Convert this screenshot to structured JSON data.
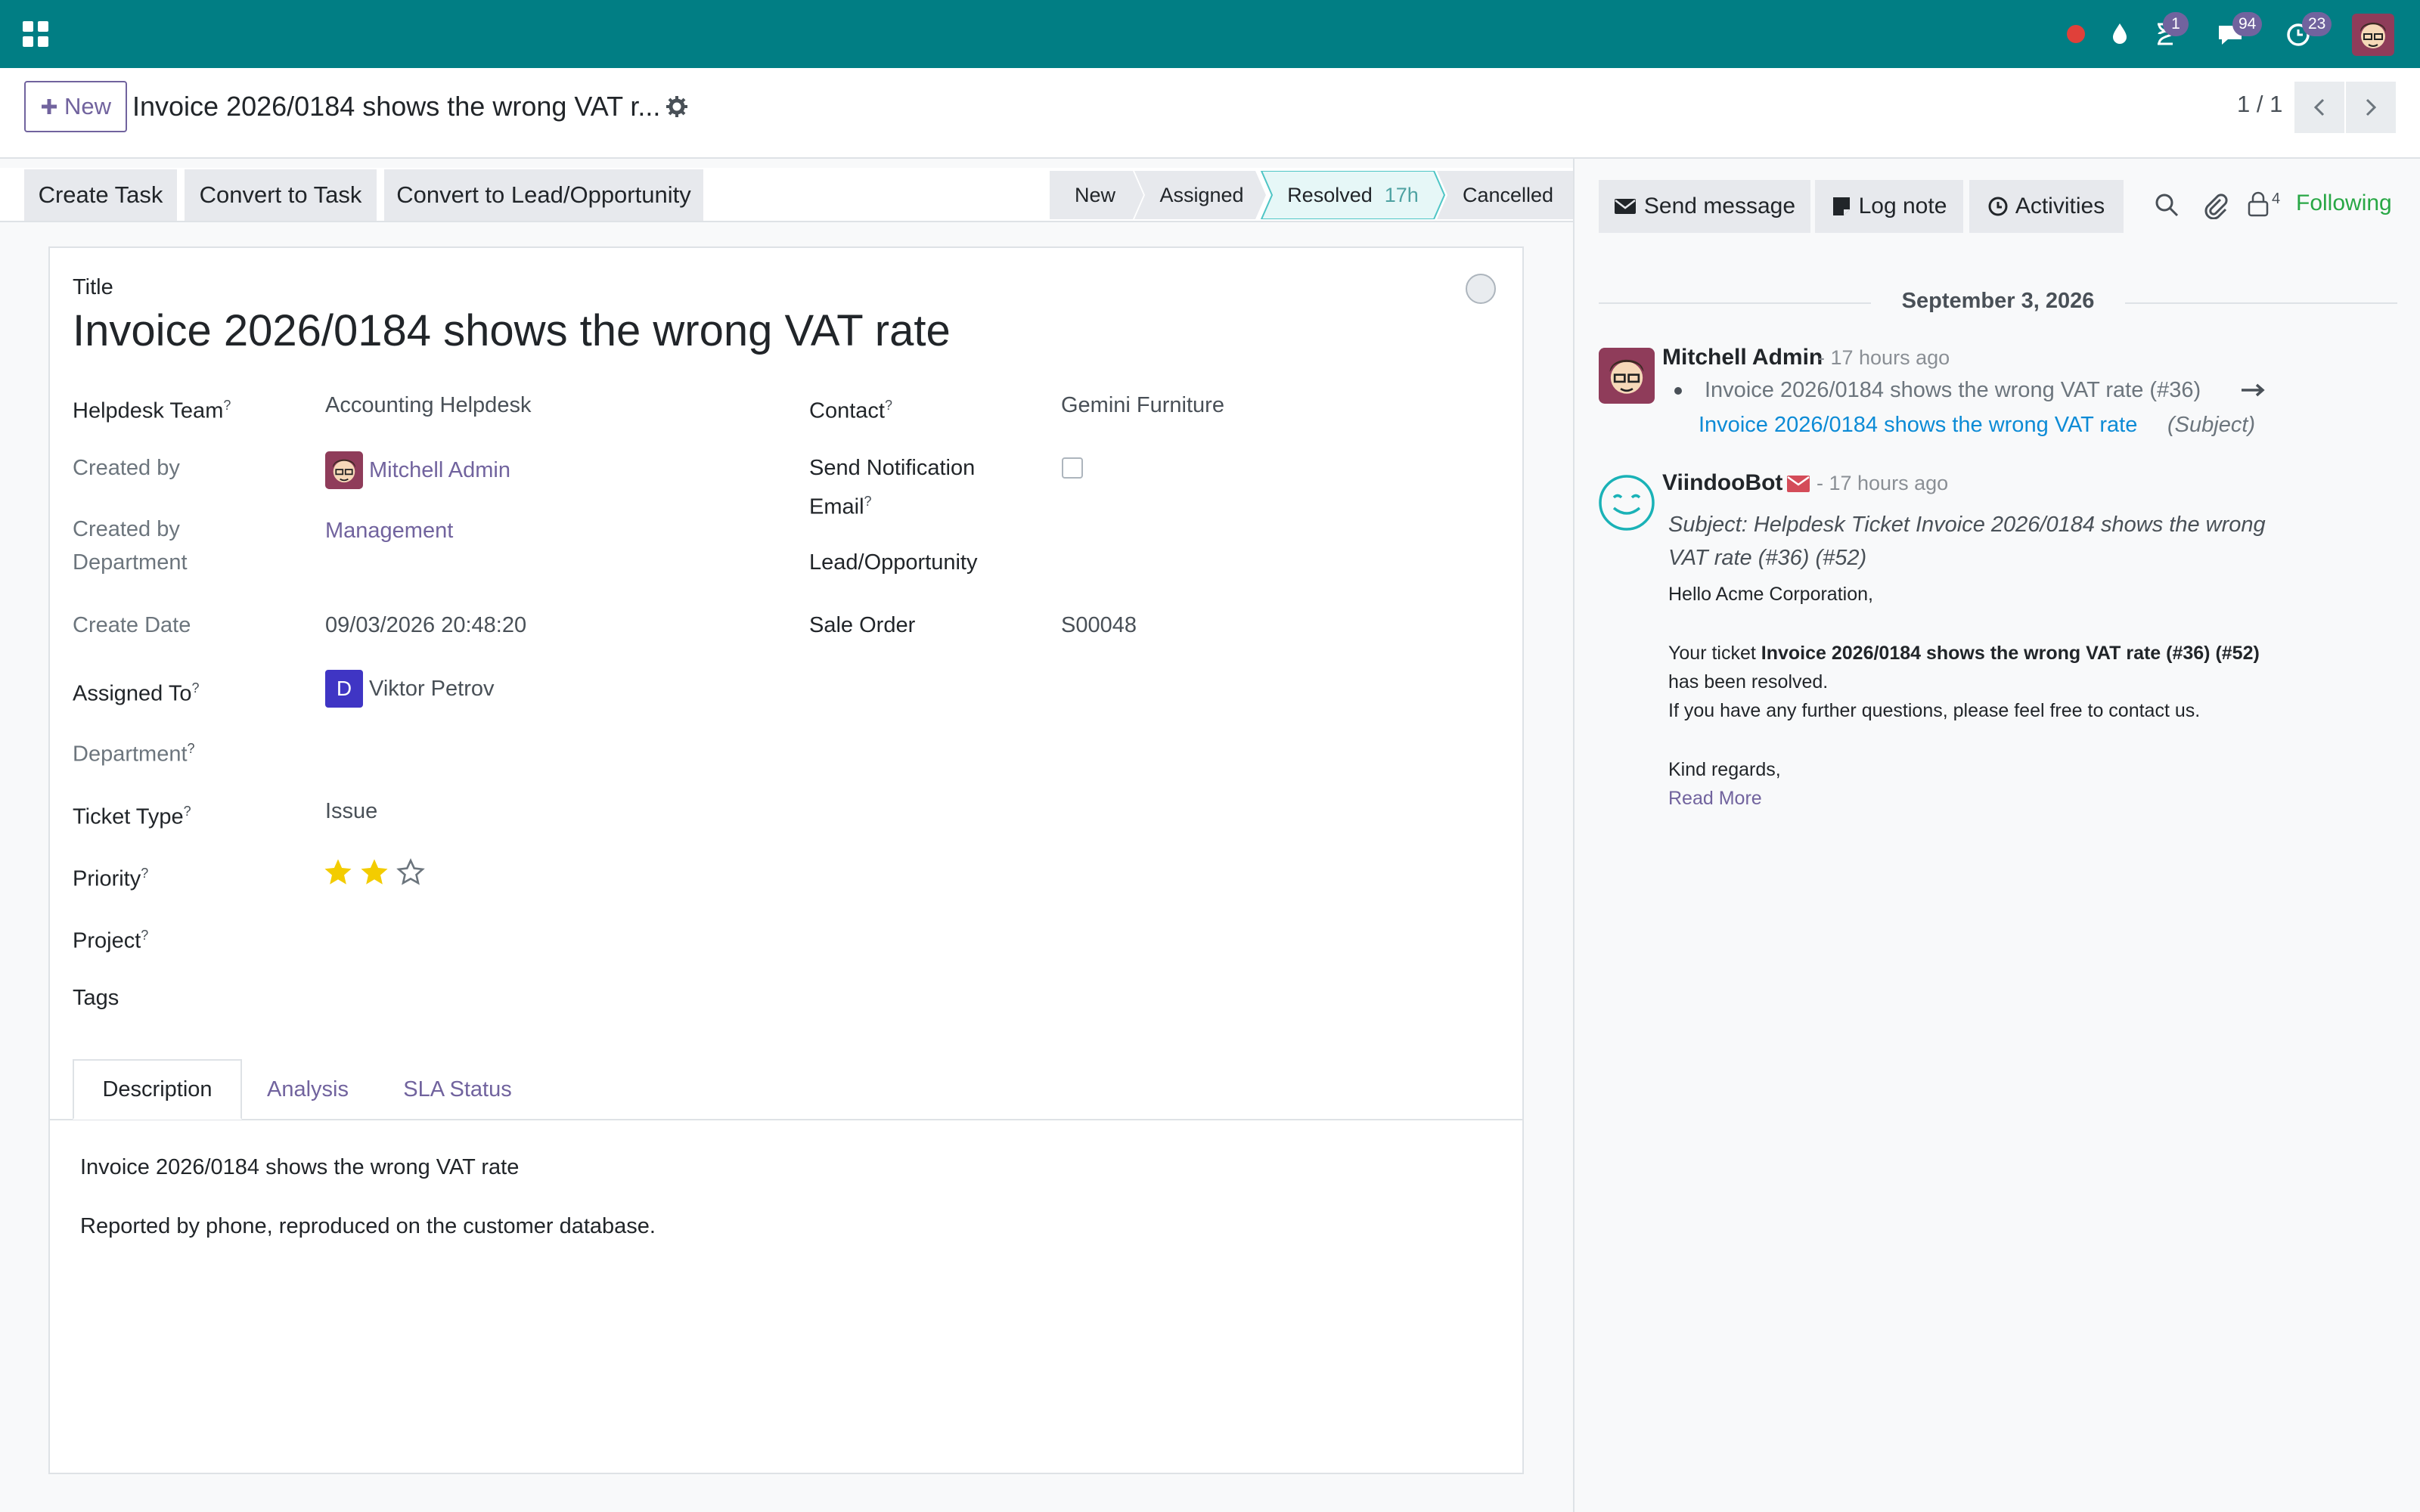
{
  "navbar": {
    "activity_badge": "1",
    "messages_badge": "94",
    "timesheet_badge": "23"
  },
  "control_panel": {
    "new_label": "New",
    "breadcrumb": "Invoice 2026/0184 shows the wrong VAT r...",
    "pager": "1 / 1"
  },
  "actions": {
    "create_task": "Create Task",
    "convert_task": "Convert to Task",
    "convert_lead": "Convert to Lead/Opportunity"
  },
  "stages": {
    "new": "New",
    "assigned": "Assigned",
    "resolved": "Resolved",
    "resolved_duration": "17h",
    "cancelled": "Cancelled"
  },
  "form": {
    "title_label": "Title",
    "title": "Invoice 2026/0184 shows the wrong VAT rate",
    "fields": {
      "helpdesk_team_label": "Helpdesk Team",
      "helpdesk_team": "Accounting Helpdesk",
      "created_by_label": "Created by",
      "created_by": "Mitchell Admin",
      "created_by_dept_label_1": "Created by",
      "created_by_dept_label_2": "Department",
      "created_by_dept": "Management",
      "create_date_label": "Create Date",
      "create_date": "09/03/2026 20:48:20",
      "assigned_to_label": "Assigned To",
      "assigned_to_initial": "D",
      "assigned_to": "Viktor Petrov",
      "department_label": "Department",
      "ticket_type_label": "Ticket Type",
      "ticket_type": "Issue",
      "priority_label": "Priority",
      "priority_value": 2,
      "priority_max": 3,
      "project_label": "Project",
      "tags_label": "Tags",
      "contact_label": "Contact",
      "contact": "Gemini Furniture",
      "send_notif_label_1": "Send Notification",
      "send_notif_label_2": "Email",
      "send_notification": false,
      "lead_label": "Lead/Opportunity",
      "sale_order_label": "Sale Order",
      "sale_order": "S00048",
      "help_mark": "?"
    },
    "tabs": [
      "Description",
      "Analysis",
      "SLA Status"
    ],
    "description": [
      "Invoice 2026/0184 shows the wrong VAT rate",
      "Reported by phone, reproduced on the customer database."
    ]
  },
  "chatter": {
    "send_message": "Send message",
    "log_note": "Log note",
    "activities": "Activities",
    "followers_count": "4",
    "following": "Following",
    "date_separator": "September 3, 2026",
    "messages": [
      {
        "author": "Mitchell Admin",
        "time": "- 17 hours ago",
        "change_old": "Invoice 2026/0184 shows the wrong VAT rate (#36)",
        "change_new": "Invoice 2026/0184 shows the wrong VAT rate",
        "change_field": "(Subject)"
      },
      {
        "author": "ViindooBot",
        "time": "- 17 hours ago",
        "subject_line_1": "Subject: Helpdesk Ticket Invoice 2026/0184 shows the wrong",
        "subject_line_2": "VAT rate (#36) (#52)",
        "greeting": "Hello Acme Corporation,",
        "body_prefix": "Your ticket",
        "body_bold": "Invoice 2026/0184 shows the wrong VAT rate (#36) (#52)",
        "body_line_2": "has been resolved.",
        "body_line_3": "If you have any further questions, please feel free to contact us.",
        "closing": "Kind regards,",
        "read_more": "Read More"
      }
    ]
  },
  "colors": {
    "navbar": "#017e84",
    "brand": "#71639e",
    "star": "#f3cc00",
    "following": "#28a745",
    "resolved_bg": "#e6f7f7",
    "resolved_border": "#4ec5c5",
    "link_blue": "#0c8bd6"
  }
}
